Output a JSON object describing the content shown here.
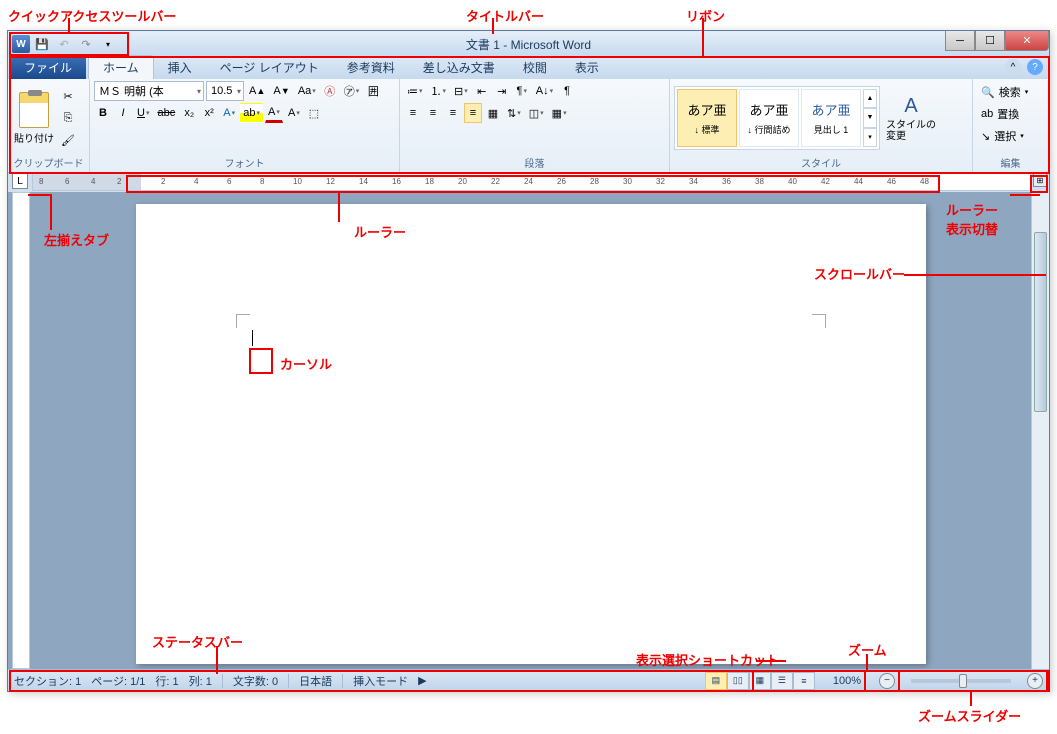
{
  "title": "文書 1 - Microsoft Word",
  "tabs": {
    "file": "ファイル",
    "home": "ホーム",
    "insert": "挿入",
    "layout": "ページ レイアウト",
    "ref": "参考資料",
    "mail": "差し込み文書",
    "review": "校閲",
    "view": "表示"
  },
  "clipboard": {
    "paste": "貼り付け",
    "label": "クリップボード"
  },
  "font": {
    "name": "ＭＳ 明朝 (本",
    "size": "10.5",
    "label": "フォント"
  },
  "para": {
    "label": "段落"
  },
  "styles": {
    "label": "スタイル",
    "normal": "あア亜",
    "normal_lbl": "↓ 標準",
    "nogap": "あア亜",
    "nogap_lbl": "↓ 行間詰め",
    "h1": "あア亜",
    "h1_lbl": "見出し 1",
    "change": "スタイルの\n変更"
  },
  "edit": {
    "label": "編集",
    "find": "検索",
    "replace": "置換",
    "select": "選択"
  },
  "status": {
    "section": "セクション: 1",
    "page": "ページ: 1/1",
    "line": "行: 1",
    "col": "列: 1",
    "chars": "文字数: 0",
    "lang": "日本語",
    "mode": "挿入モード",
    "zoom": "100%"
  },
  "ruler_ticks_left": [
    "8",
    "6",
    "4",
    "2"
  ],
  "ruler_ticks": [
    "2",
    "4",
    "6",
    "8",
    "10",
    "12",
    "14",
    "16",
    "18",
    "20",
    "22",
    "24",
    "26",
    "28",
    "30",
    "32",
    "34",
    "36",
    "38",
    "40",
    "42",
    "44",
    "46",
    "48"
  ],
  "anno": {
    "qat": "クイックアクセスツールバー",
    "title": "タイトルバー",
    "ribbon": "リボン",
    "tabsel": "左揃えタブ",
    "rulerh": "ルーラー",
    "rulertoggle": "ルーラー\n表示切替",
    "cursor": "カーソル",
    "scroll": "スクロールバー",
    "status": "ステータスバー",
    "viewshort": "表示選択ショートカット",
    "zoom": "ズーム",
    "zoomslider": "ズームスライダー"
  }
}
